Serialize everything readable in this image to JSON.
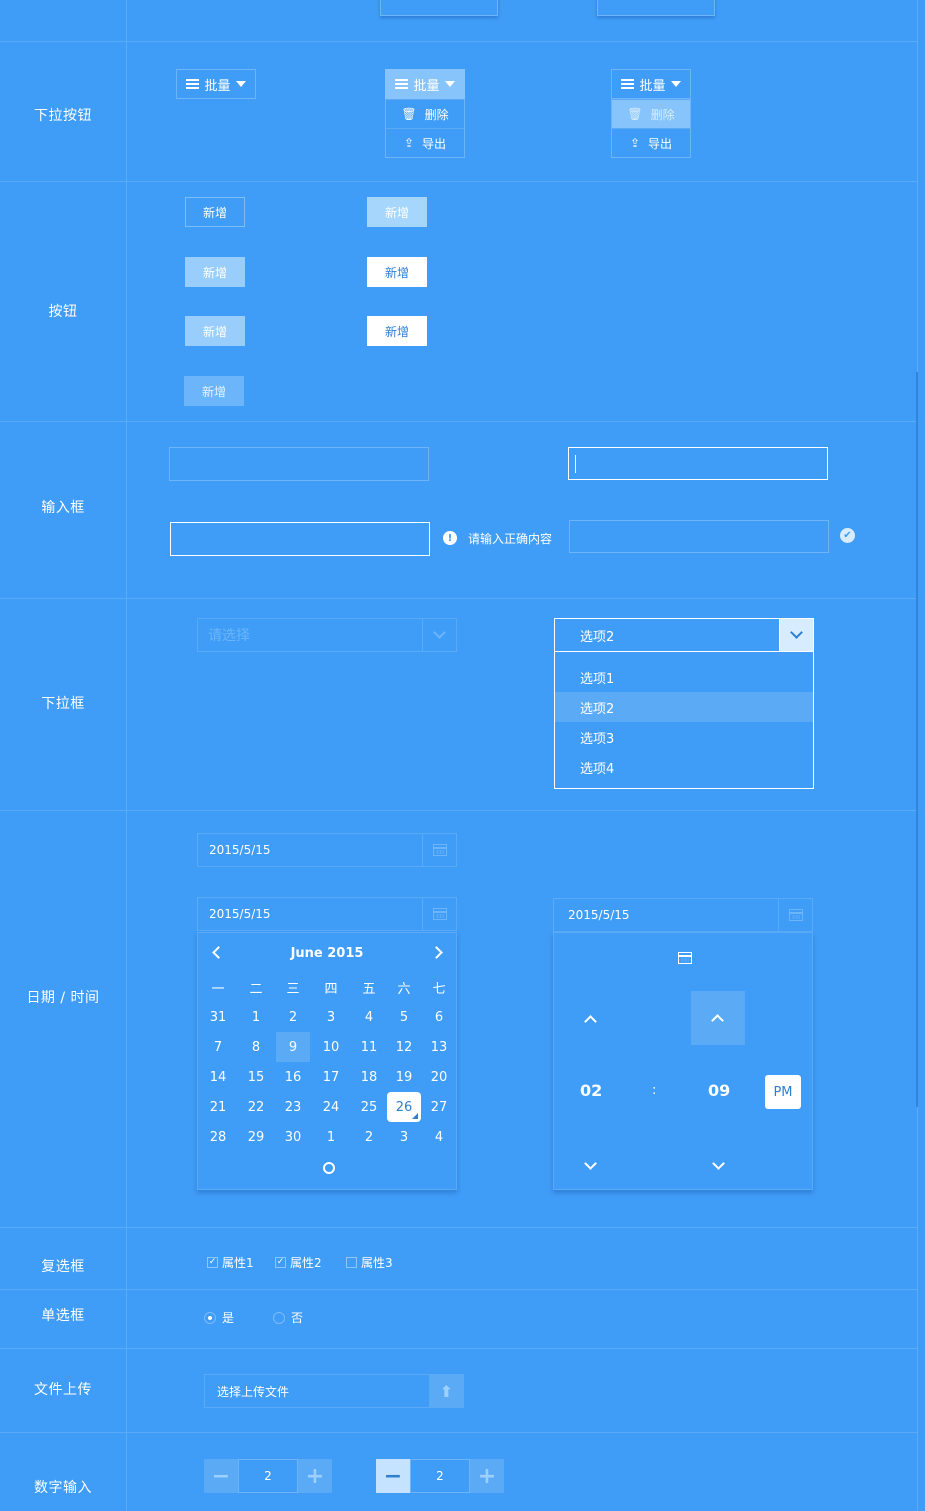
{
  "rows": {
    "dropdown_button": "下拉按钮",
    "button": "按钮",
    "input": "输入框",
    "select": "下拉框",
    "datetime": "日期 / 时间",
    "checkbox": "复选框",
    "radio": "单选框",
    "file_upload": "文件上传",
    "number_input": "数字输入"
  },
  "dropdown": {
    "label": "批量",
    "delete_label": "删除",
    "export_label": "导出"
  },
  "buttons": {
    "add_label": "新增"
  },
  "input": {
    "error_message": "请输入正确内容"
  },
  "select": {
    "placeholder": "请选择",
    "selected": "选项2",
    "options": [
      "选项1",
      "选项2",
      "选项3",
      "选项4"
    ]
  },
  "date": {
    "value": "2015/5/15",
    "month_title": "June 2015",
    "weekdays": [
      "一",
      "二",
      "三",
      "四",
      "五",
      "六",
      "七"
    ],
    "days": [
      [
        "31",
        "1",
        "2",
        "3",
        "4",
        "5",
        "6"
      ],
      [
        "7",
        "8",
        "9",
        "10",
        "11",
        "12",
        "13"
      ],
      [
        "14",
        "15",
        "16",
        "17",
        "18",
        "19",
        "20"
      ],
      [
        "21",
        "22",
        "23",
        "24",
        "25",
        "26",
        "27"
      ],
      [
        "28",
        "29",
        "30",
        "1",
        "2",
        "3",
        "4"
      ]
    ],
    "highlighted_day": "9",
    "today_day": "26"
  },
  "time": {
    "hour": "02",
    "separator": ":",
    "minute": "09",
    "period": "PM"
  },
  "checkboxes": [
    {
      "label": "属性1",
      "checked": true
    },
    {
      "label": "属性2",
      "checked": true
    },
    {
      "label": "属性3",
      "checked": false
    }
  ],
  "radios": [
    {
      "label": "是",
      "selected": true
    },
    {
      "label": "否",
      "selected": false
    }
  ],
  "file": {
    "placeholder": "选择上传文件"
  },
  "number": {
    "value": "2",
    "minus": "−",
    "plus": "+"
  }
}
